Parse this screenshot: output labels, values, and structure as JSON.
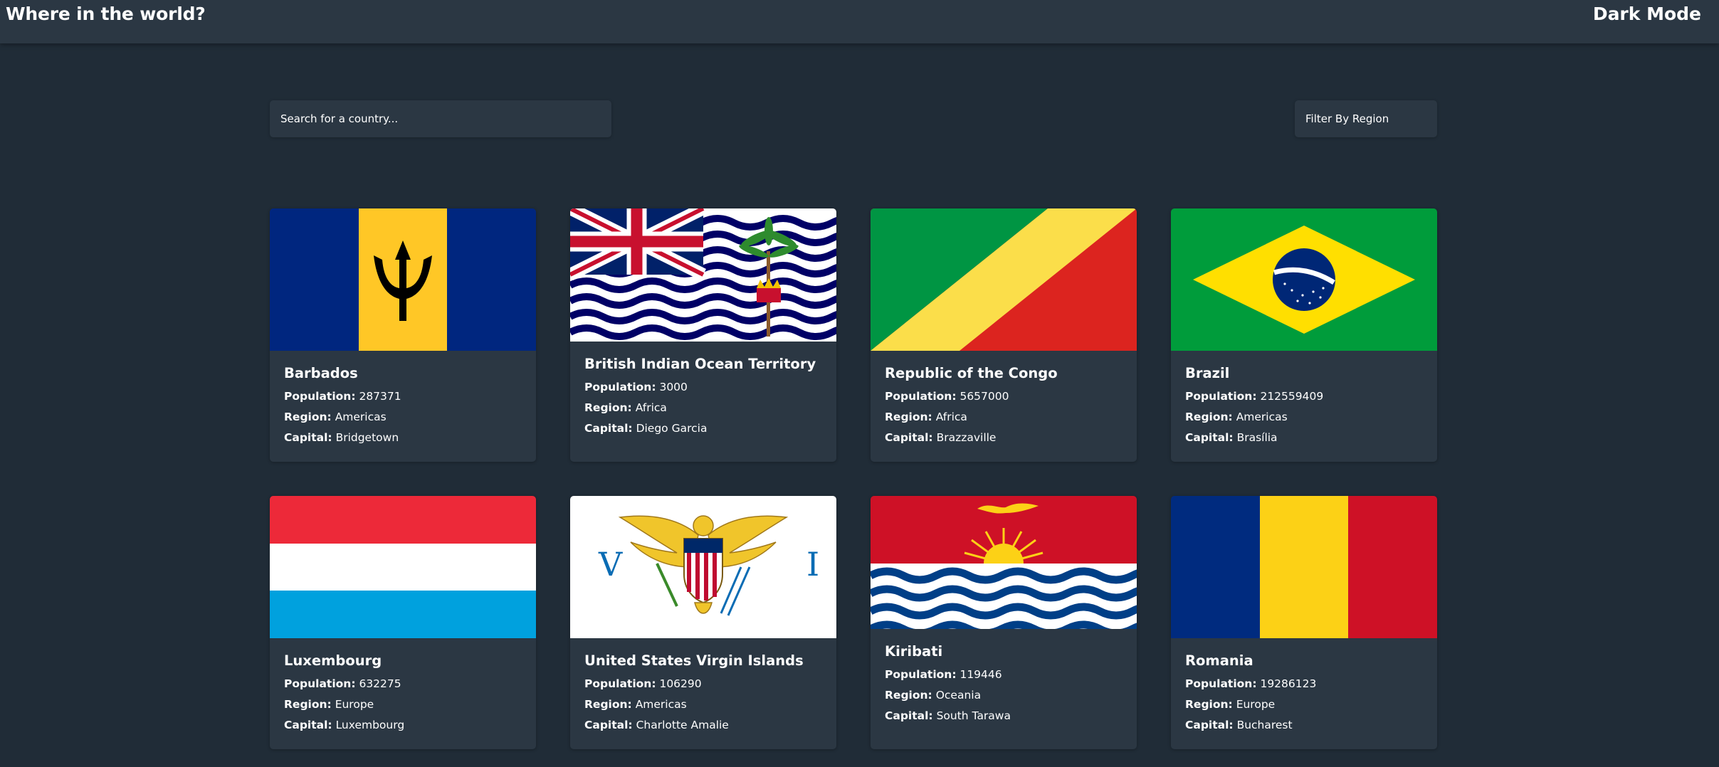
{
  "header": {
    "title": "Where in the world?",
    "mode_label": "Dark Mode"
  },
  "search": {
    "placeholder": "Search for a country..."
  },
  "filter": {
    "label": "Filter By Region"
  },
  "labels": {
    "population": "Population:",
    "region": "Region:",
    "capital": "Capital:"
  },
  "countries": [
    {
      "name": "Barbados",
      "population": "287371",
      "region": "Americas",
      "capital": "Bridgetown",
      "flag_icon": "barbados-flag"
    },
    {
      "name": "British Indian Ocean Territory",
      "population": "3000",
      "region": "Africa",
      "capital": "Diego Garcia",
      "flag_icon": "biot-flag"
    },
    {
      "name": "Republic of the Congo",
      "population": "5657000",
      "region": "Africa",
      "capital": "Brazzaville",
      "flag_icon": "congo-flag"
    },
    {
      "name": "Brazil",
      "population": "212559409",
      "region": "Americas",
      "capital": "Brasília",
      "flag_icon": "brazil-flag"
    },
    {
      "name": "Luxembourg",
      "population": "632275",
      "region": "Europe",
      "capital": "Luxembourg",
      "flag_icon": "luxembourg-flag"
    },
    {
      "name": "United States Virgin Islands",
      "population": "106290",
      "region": "Americas",
      "capital": "Charlotte Amalie",
      "flag_icon": "usvi-flag"
    },
    {
      "name": "Kiribati",
      "population": "119446",
      "region": "Oceania",
      "capital": "South Tarawa",
      "flag_icon": "kiribati-flag"
    },
    {
      "name": "Romania",
      "population": "19286123",
      "region": "Europe",
      "capital": "Bucharest",
      "flag_icon": "romania-flag"
    }
  ],
  "colors": {
    "background": "#202c37",
    "element": "#2b3743",
    "text": "#ffffff"
  }
}
